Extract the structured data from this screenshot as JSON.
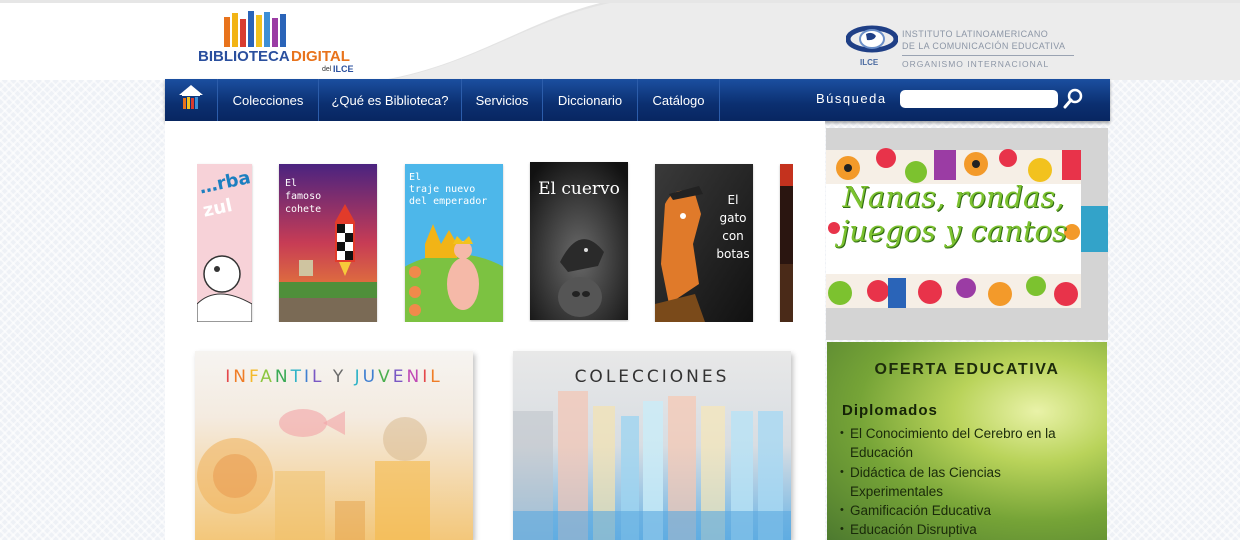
{
  "header": {
    "logo": {
      "word1": "BIBLIOTECA",
      "word2": "DIGITAL",
      "del": "del",
      "org": "ILCE",
      "stripe_colors": [
        "#e8731c",
        "#f2b416",
        "#d93b2f",
        "#2a64b8",
        "#f2c21e",
        "#3d8fd6",
        "#9b3ca4",
        "#2a64b8"
      ]
    },
    "ilce": {
      "line1": "INSTITUTO LATINOAMERICANO",
      "line2": "DE LA COMUNICACIÓN EDUCATIVA",
      "line3": "ORGANISMO INTERNACIONAL",
      "abbr": "ILCE"
    }
  },
  "nav": {
    "home_icon": "home-books-icon",
    "items": [
      {
        "label": "Colecciones"
      },
      {
        "label": "¿Qué es Biblioteca?"
      },
      {
        "label": "Servicios"
      },
      {
        "label": "Diccionario"
      },
      {
        "label": "Catálogo"
      }
    ],
    "search": {
      "label": "Búsqueda",
      "value": "",
      "placeholder": "",
      "icon": "magnifier-icon"
    }
  },
  "carousel": {
    "books": [
      {
        "title": "…rba\n…zul",
        "colors": [
          "#f6c8cf",
          "#1c7fc0"
        ]
      },
      {
        "title": "El\nfamoso\ncohete",
        "colors": [
          "#e8462a",
          "#5e2b7a"
        ]
      },
      {
        "title": "El\ntraje nuevo\ndel emperador",
        "colors": [
          "#4fb6e8",
          "#7cc241"
        ]
      },
      {
        "title": "El cuervo",
        "colors": [
          "#1a1a1a",
          "#6a6a6a"
        ]
      },
      {
        "title": "El\ngato\ncon\nbotas",
        "colors": [
          "#2b2b2b",
          "#e07a2a"
        ]
      }
    ]
  },
  "tiles": [
    {
      "title_letters": [
        {
          "ch": "I",
          "color": "#e4484b"
        },
        {
          "ch": "N",
          "color": "#ef7d27"
        },
        {
          "ch": "F",
          "color": "#f4b92a"
        },
        {
          "ch": "A",
          "color": "#8dc63f"
        },
        {
          "ch": "N",
          "color": "#3aaa55"
        },
        {
          "ch": "T",
          "color": "#2fb3c7"
        },
        {
          "ch": "I",
          "color": "#3f7fd1"
        },
        {
          "ch": "L",
          "color": "#7a58c4"
        },
        {
          "ch": " ",
          "color": "#000000"
        },
        {
          "ch": "Y",
          "color": "#6b6b6b"
        },
        {
          "ch": " ",
          "color": "#000000"
        },
        {
          "ch": "J",
          "color": "#2fb3c7"
        },
        {
          "ch": "U",
          "color": "#3f7fd1"
        },
        {
          "ch": "V",
          "color": "#4caf50"
        },
        {
          "ch": "E",
          "color": "#7a58c4"
        },
        {
          "ch": "N",
          "color": "#c04ab6"
        },
        {
          "ch": "I",
          "color": "#e4484b"
        },
        {
          "ch": "L",
          "color": "#ef7d27"
        }
      ]
    },
    {
      "title": "COLECCIONES"
    }
  ],
  "banner": {
    "line1": "Nanas, rondas,",
    "line2": "juegos y cantos"
  },
  "oferta": {
    "title": "OFERTA EDUCATIVA",
    "subtitle": "Diplomados",
    "items": [
      "El Conocimiento del Cerebro en la Educación",
      "Didáctica de las Ciencias Experimentales",
      "Gamificación Educativa",
      "Educación Disruptiva"
    ]
  }
}
